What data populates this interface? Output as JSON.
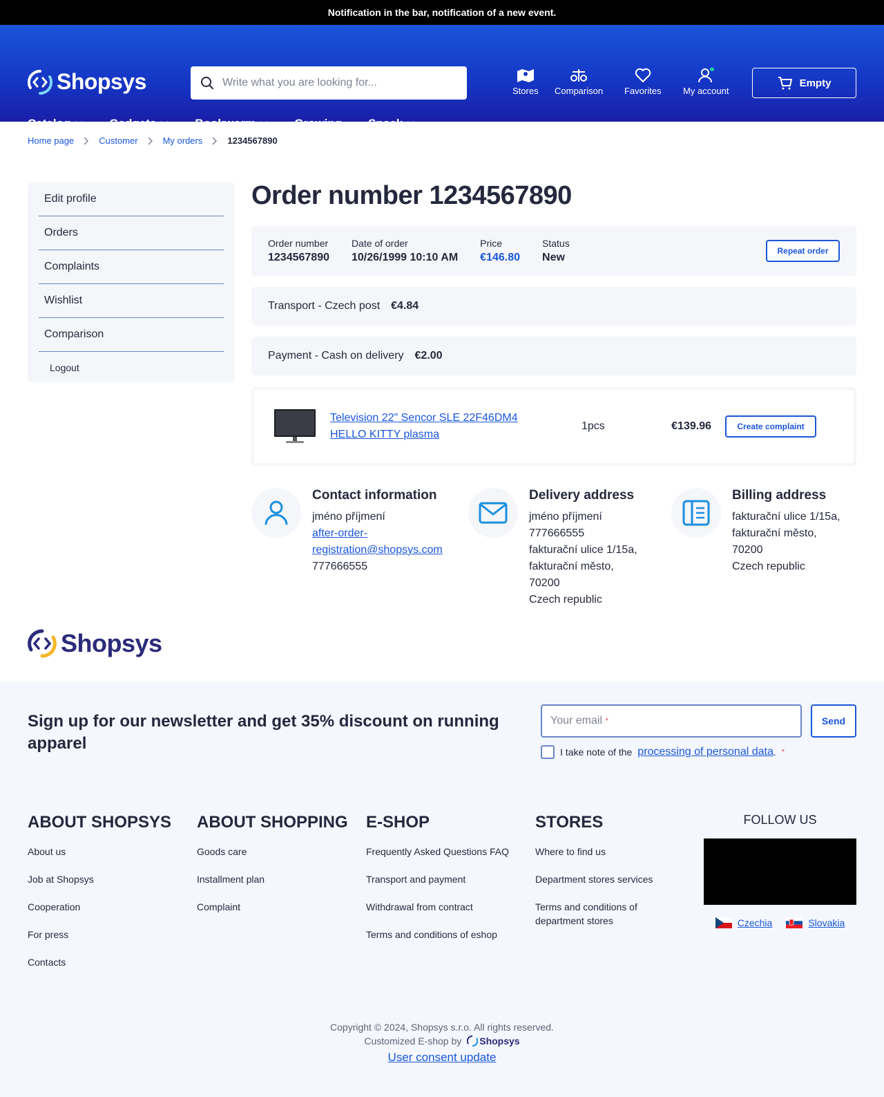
{
  "notification": "Notification in the bar, notification of a new event.",
  "header": {
    "logo_text": "Shopsys",
    "search_placeholder": "Write what you are looking for...",
    "icons": [
      {
        "label": "Stores",
        "icon": "map-icon"
      },
      {
        "label": "Comparison",
        "icon": "scales-icon"
      },
      {
        "label": "Favorites",
        "icon": "heart-icon"
      },
      {
        "label": "My account",
        "icon": "user-icon"
      }
    ],
    "cart_label": "Empty",
    "nav": [
      "Catalog",
      "Gadgets",
      "Bookworm",
      "Growing",
      "Snack"
    ]
  },
  "breadcrumb": [
    "Home page",
    "Customer",
    "My orders",
    "1234567890"
  ],
  "sidebar": {
    "items": [
      "Edit profile",
      "Orders",
      "Complaints",
      "Wishlist",
      "Comparison"
    ],
    "logout": "Logout"
  },
  "order": {
    "title": "Order number 1234567890",
    "number_label": "Order number",
    "number": "1234567890",
    "date_label": "Date of order",
    "date": "10/26/1999 10:10 AM",
    "price_label": "Price",
    "price": "€146.80",
    "status_label": "Status",
    "status": "New",
    "repeat_button": "Repeat order",
    "transport_label": "Transport - Czech post",
    "transport_price": "€4.84",
    "payment_label": "Payment - Cash on delivery",
    "payment_price": "€2.00",
    "item": {
      "name_line1": "Television 22\" Sencor SLE 22F46DM4",
      "name_line2": "HELLO KITTY plasma",
      "quantity": "1pcs",
      "price": "€139.96",
      "complaint_button": "Create complaint"
    }
  },
  "contact": {
    "title": "Contact information",
    "name": "jméno příjmení",
    "email_line1": "after-order-",
    "email_line2": "registration@shopsys.com",
    "phone": "777666555"
  },
  "delivery": {
    "title": "Delivery address",
    "lines": [
      "jméno příjmení",
      "777666555",
      "fakturační ulice 1/15a,",
      "fakturační město,",
      "70200",
      "Czech republic"
    ]
  },
  "billing": {
    "title": "Billing address",
    "lines": [
      "fakturační ulice 1/15a,",
      "fakturační město,",
      "70200",
      "Czech republic"
    ]
  },
  "footer": {
    "logo_text": "Shopsys",
    "newsletter_title": "Sign up for our newsletter and get 35% discount on running apparel",
    "email_placeholder": "Your email",
    "send": "Send",
    "consent_prefix": "I take note of the",
    "consent_link": "processing of personal data",
    "columns": [
      {
        "title": "ABOUT SHOPSYS",
        "links": [
          "About us",
          "Job at Shopsys",
          "Cooperation",
          "For press",
          "Contacts"
        ]
      },
      {
        "title": "ABOUT SHOPPING",
        "links": [
          "Goods care",
          "Installment plan",
          "Complaint"
        ]
      },
      {
        "title": "E-SHOP",
        "links": [
          "Frequently Asked Questions FAQ",
          "Transport and payment",
          "Withdrawal from contract",
          "Terms and conditions of eshop"
        ]
      },
      {
        "title": "STORES",
        "links": [
          "Where to find us",
          "Department stores services",
          "Terms and conditions of department stores"
        ]
      }
    ],
    "follow_title": "FOLLOW US",
    "countries": [
      "Czechia",
      "Slovakia"
    ],
    "copyright": "Copyright © 2024, Shopsys s.r.o. All rights reserved.",
    "customized_by": "Customized E-shop by",
    "brand": "Shopsys",
    "consent_update": "User consent update"
  },
  "colors": {
    "accent": "#1a56db",
    "header_dark": "#1a1fa8",
    "text": "#25283d",
    "panel": "#f5f6f9"
  }
}
